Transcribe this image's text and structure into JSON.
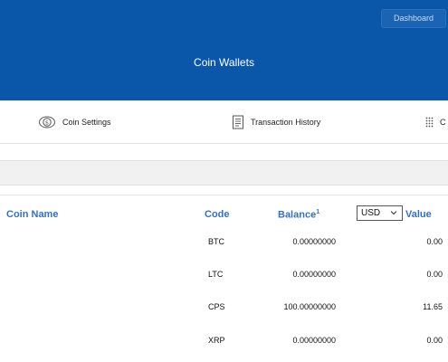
{
  "header": {
    "dashboard_label": "Dashboard",
    "title": "Coin Wallets"
  },
  "tabs": [
    {
      "label": "Coin Settings",
      "icon": "coin-settings-icon"
    },
    {
      "label": "Transaction History",
      "icon": "transaction-history-icon"
    },
    {
      "label": "C",
      "icon": "grid-dots-icon"
    }
  ],
  "table": {
    "columns": {
      "coin_name": "Coin Name",
      "code": "Code",
      "balance": "Balance",
      "balance_note": "1",
      "value": "Value"
    },
    "currency_selected": "USD",
    "rows": [
      {
        "code": "BTC",
        "balance": "0.00000000",
        "value": "0.00"
      },
      {
        "code": "LTC",
        "balance": "0.00000000",
        "value": "0.00"
      },
      {
        "code": "CPS",
        "balance": "100.00000000",
        "value": "11.65"
      },
      {
        "code": "XRP",
        "balance": "0.00000000",
        "value": "0.00"
      }
    ]
  },
  "colors": {
    "header_bg": "#0a56a8",
    "column_header_text": "#3a70b8"
  }
}
